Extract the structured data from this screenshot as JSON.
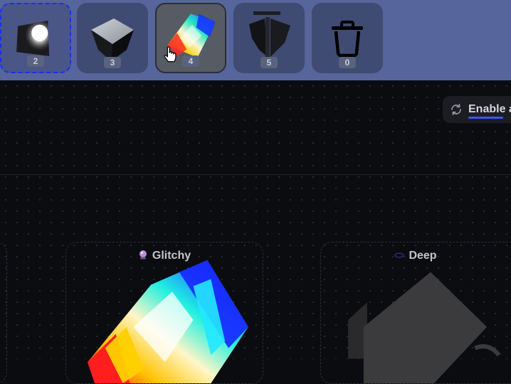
{
  "toolbar": {
    "slots": [
      {
        "count": "2",
        "icon": "glowing-cube-icon",
        "state": "selected"
      },
      {
        "count": "3",
        "icon": "deep-cube-icon",
        "state": "normal"
      },
      {
        "count": "4",
        "icon": "glitchy-cube-icon",
        "state": "hovered"
      },
      {
        "count": "5",
        "icon": "shield-icon",
        "state": "normal"
      },
      {
        "count": "0",
        "icon": "trash-icon",
        "state": "normal"
      }
    ]
  },
  "controls": {
    "toggle_label": "Enable a",
    "toggle_icon": "refresh-icon"
  },
  "cards": [
    {
      "title": "Glitchy",
      "icon": "crystal-ball-icon"
    },
    {
      "title": "Deep",
      "icon": "hole-icon"
    }
  ],
  "colors": {
    "toolbar_bg": "#56659b",
    "slot_bg": "#3f4b72",
    "selected_border": "#1a2dff",
    "canvas_bg": "#0b0c10",
    "accent_underline": "#3b55ff"
  }
}
